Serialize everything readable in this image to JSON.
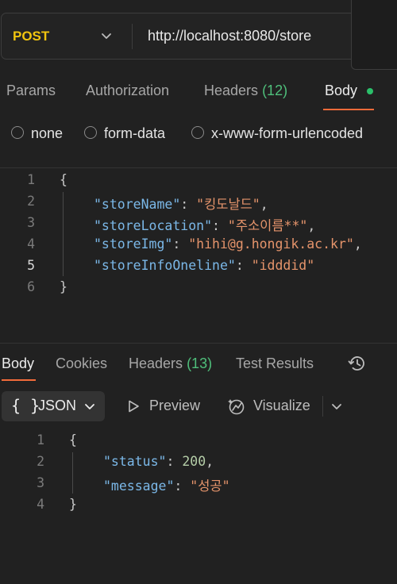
{
  "request": {
    "method": "POST",
    "url": "http://localhost:8080/store"
  },
  "request_tabs": [
    {
      "label": "Params"
    },
    {
      "label": "Authorization"
    },
    {
      "label": "Headers",
      "count": "(12)"
    },
    {
      "label": "Body"
    }
  ],
  "body_types": [
    "none",
    "form-data",
    "x-www-form-urlencoded"
  ],
  "request_body": {
    "line_numbers": [
      "1",
      "2",
      "3",
      "4",
      "5",
      "6"
    ],
    "open_brace": "{",
    "close_brace": "}",
    "fields": [
      {
        "key": "\"storeName\"",
        "value": "\"킹도날드\""
      },
      {
        "key": "\"storeLocation\"",
        "value": "\"주소이름**\""
      },
      {
        "key": "\"storeImg\"",
        "value": "\"hihi@g.hongik.ac.kr\""
      },
      {
        "key": "\"storeInfoOneline\"",
        "value": "\"idddid\""
      }
    ]
  },
  "response_tabs": [
    {
      "label": "Body"
    },
    {
      "label": "Cookies"
    },
    {
      "label": "Headers",
      "count": "(13)"
    },
    {
      "label": "Test Results"
    }
  ],
  "response_toolbar": {
    "format_icon": "{ }",
    "format": "JSON",
    "preview": "Preview",
    "visualize": "Visualize"
  },
  "response_body": {
    "line_numbers": [
      "1",
      "2",
      "3",
      "4"
    ],
    "open_brace": "{",
    "close_brace": "}",
    "fields": [
      {
        "key": "\"status\"",
        "value": "200"
      },
      {
        "key": "\"message\"",
        "value": "\"성공\""
      }
    ]
  },
  "colors": {
    "method": "#f1c40f",
    "accent": "#f26b3a",
    "count": "#4fbf7b",
    "json_key": "#7bb8e8",
    "json_string": "#e5946b"
  }
}
